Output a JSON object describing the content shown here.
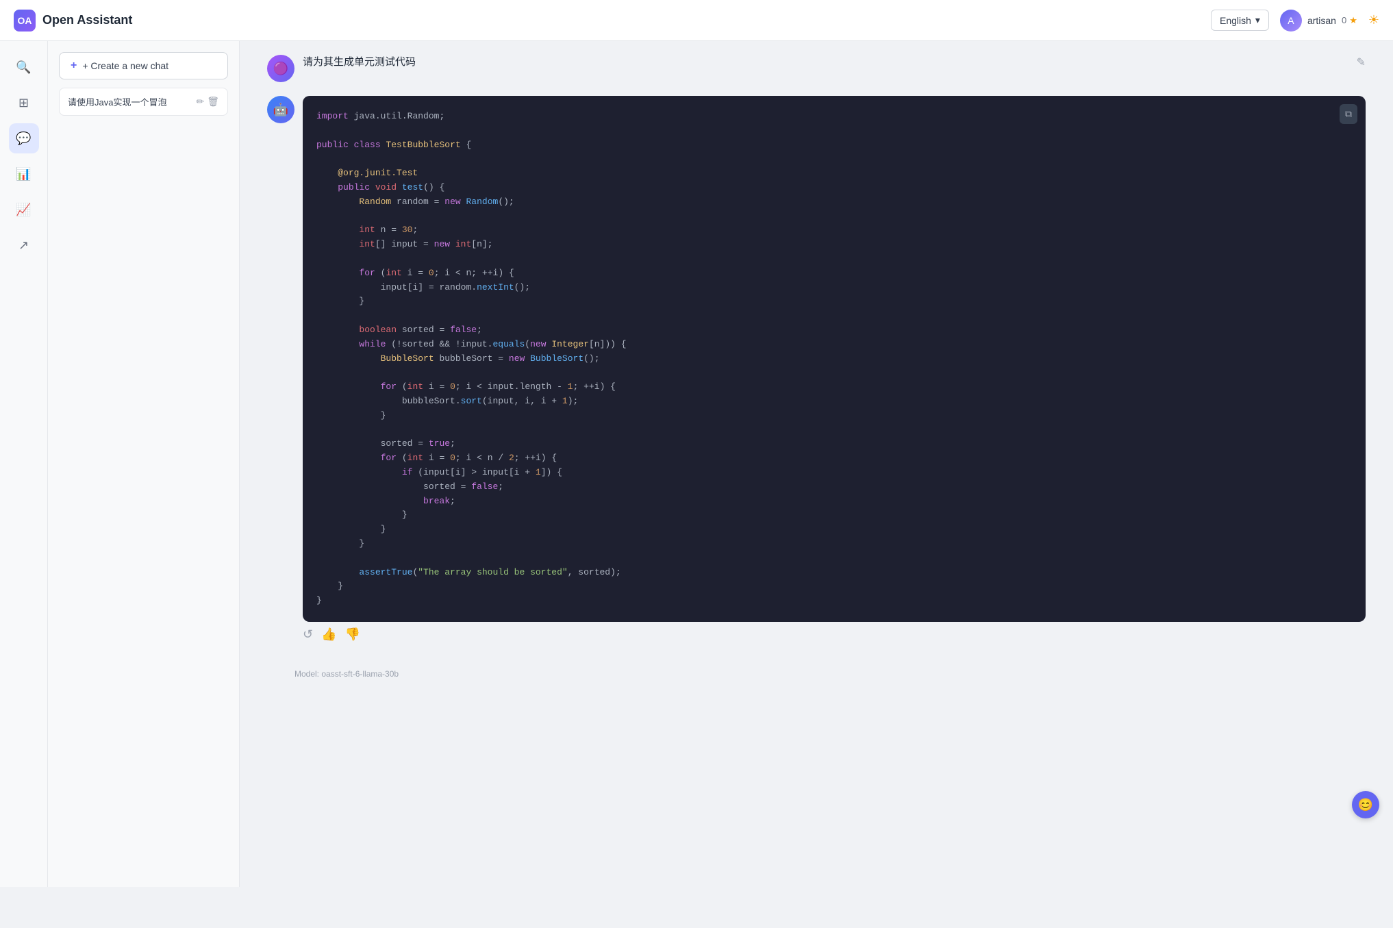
{
  "navbar": {
    "logo_text": "OA",
    "title": "Open Assistant",
    "lang_label": "English",
    "user_name": "artisan",
    "user_stars": "0",
    "star_symbol": "★",
    "sun_symbol": "☀"
  },
  "sidebar_icons": [
    {
      "name": "search-icon",
      "symbol": "🔍"
    },
    {
      "name": "grid-icon",
      "symbol": "⊞"
    },
    {
      "name": "chat-icon",
      "symbol": "💬"
    },
    {
      "name": "chart-icon",
      "symbol": "📊"
    },
    {
      "name": "trending-icon",
      "symbol": "📈"
    },
    {
      "name": "export-icon",
      "symbol": "↗"
    }
  ],
  "new_chat_label": "+ Create a new chat",
  "chat_items": [
    {
      "text": "请使用Java实现一个冒泡",
      "has_edit": true,
      "has_delete": true
    }
  ],
  "chat": {
    "user_message": "请为其生成单元测试代码",
    "code_content": "import java.util.Random;\n\npublic class TestBubbleSort {\n\n    @org.junit.Test\n    public void test() {\n        Random random = new Random();\n\n        int n = 30;\n        int[] input = new int[n];\n\n        for (int i = 0; i < n; ++i) {\n            input[i] = random.nextInt();\n        }\n\n        boolean sorted = false;\n        while (!sorted && !input.equals(new Integer[n])) {\n            BubbleSort bubbleSort = new BubbleSort();\n\n            for (int i = 0; i < input.length - 1; ++i) {\n                bubbleSort.sort(input, i, i + 1);\n            }\n\n            sorted = true;\n            for (int i = 0; i < n / 2; ++i) {\n                if (input[i] > input[i + 1]) {\n                    sorted = false;\n                    break;\n                }\n            }\n        }\n\n        assertTrue(\"The array should be sorted\", sorted);\n    }\n}",
    "model_label": "Model: oasst-sft-6-llama-30b"
  },
  "toolbar": {
    "refresh_icon": "↺",
    "like_icon": "👍",
    "dislike_icon": "👎"
  },
  "feedback_icon": "🤖"
}
